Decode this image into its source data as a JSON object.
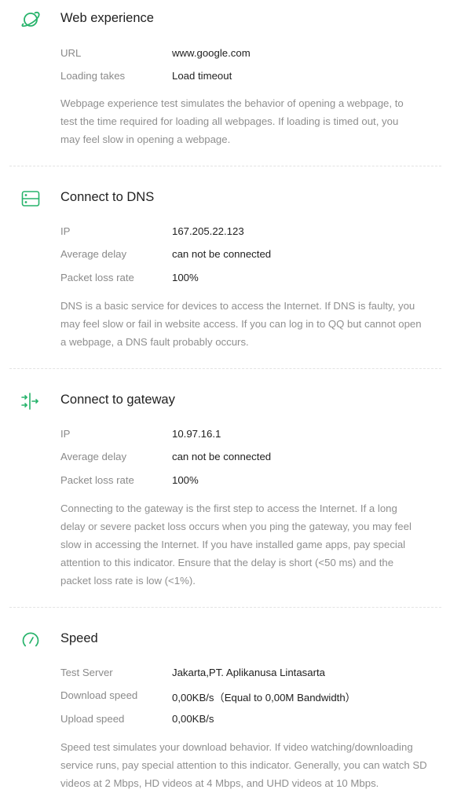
{
  "colors": {
    "accent": "#27b36b",
    "title": "#1f1f1f",
    "label": "#8a8a8a",
    "description": "#8f8f8f",
    "divider": "#e3e3e3"
  },
  "sections": [
    {
      "icon": "planet-icon",
      "title": "Web experience",
      "rows": [
        {
          "label": "URL",
          "value": "www.google.com"
        },
        {
          "label": "Loading takes",
          "value": "Load timeout"
        }
      ],
      "description_lines": [
        "Webpage experience test simulates the behavior of opening a webpage, to",
        "test the time required for loading all webpages. If loading is timed out, you",
        "may feel slow in opening a webpage."
      ]
    },
    {
      "icon": "server-icon",
      "title": "Connect to DNS",
      "rows": [
        {
          "label": "IP",
          "value": "167.205.22.123"
        },
        {
          "label": "Average delay",
          "value": "can not be connected"
        },
        {
          "label": "Packet loss rate",
          "value": "100%"
        }
      ],
      "description_lines": [
        "DNS is a basic service for devices to access the Internet. If DNS is faulty, you",
        "may feel slow or fail in website access. If you can log in to QQ but cannot open",
        "a webpage, a DNS fault probably occurs."
      ]
    },
    {
      "icon": "gateway-arrows-icon",
      "title": "Connect to gateway",
      "rows": [
        {
          "label": "IP",
          "value": "10.97.16.1"
        },
        {
          "label": "Average delay",
          "value": "can not be connected"
        },
        {
          "label": "Packet loss rate",
          "value": "100%"
        }
      ],
      "description_lines": [
        "Connecting to the gateway is the first step to access the Internet. If a long",
        "delay or severe packet loss occurs when you ping the gateway, you may feel",
        "slow in accessing the Internet. If you have installed game apps, pay special",
        "attention to this indicator. Ensure that the delay is short (<50 ms) and the",
        "packet loss rate is low (<1%)."
      ]
    },
    {
      "icon": "speedometer-icon",
      "title": "Speed",
      "rows": [
        {
          "label": "Test Server",
          "value": "Jakarta,PT. Aplikanusa Lintasarta"
        },
        {
          "label": "Download speed",
          "value": "0,00KB/s（Equal to 0,00M Bandwidth）"
        },
        {
          "label": "Upload speed",
          "value": "0,00KB/s"
        }
      ],
      "description_lines": [
        "Speed test simulates your download behavior. If video watching/downloading",
        "service runs, pay special attention to this indicator. Generally, you can watch SD",
        "videos at 2 Mbps, HD videos at 4 Mbps, and UHD videos at 10 Mbps."
      ]
    }
  ]
}
